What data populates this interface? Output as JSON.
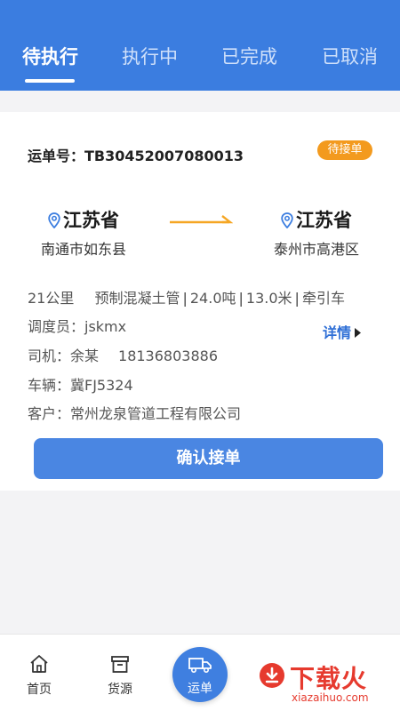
{
  "tabs": [
    {
      "label": "待执行",
      "active": true
    },
    {
      "label": "执行中",
      "active": false
    },
    {
      "label": "已完成",
      "active": false
    },
    {
      "label": "已取消",
      "active": false
    }
  ],
  "order": {
    "number_label": "运单号：",
    "number": "TB30452007080013",
    "status_badge": "待接单",
    "origin": {
      "province": "江苏省",
      "city": "南通市如东县"
    },
    "destination": {
      "province": "江苏省",
      "city": "泰州市高港区"
    },
    "specs": {
      "distance": "21公里",
      "cargo": "预制混凝土管",
      "weight": "24.0吨",
      "length": "13.0米",
      "vehicle_type": "牵引车"
    },
    "dispatcher": "调度员：jskmx",
    "driver_label": "司机：余某",
    "driver_phone": "18136803886",
    "vehicle": "车辆：冀FJ5324",
    "customer": "客户：常州龙泉管道工程有限公司",
    "details_link": "详情",
    "confirm_button": "确认接单"
  },
  "bottom_nav": {
    "home": "首页",
    "cargo_source": "货源",
    "waybill": "运单"
  },
  "watermark": {
    "text": "下载火",
    "sub": "xiazaihuo.com"
  },
  "colors": {
    "primary": "#3b7de0",
    "badge": "#f39a1e",
    "arrow": "#f5a623",
    "link": "#2f6fd6"
  },
  "icons": {
    "location": "location-pin-icon",
    "arrow": "route-arrow-icon",
    "details": "caret-right-icon",
    "home": "home-icon",
    "cargo": "box-icon",
    "waybill": "truck-icon"
  }
}
